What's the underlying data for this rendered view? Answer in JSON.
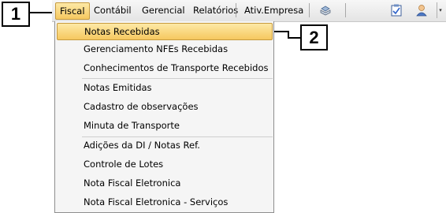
{
  "callouts": {
    "one": "1",
    "two": "2"
  },
  "menubar": {
    "items": [
      "Fiscal",
      "Contábil",
      "Gerencial",
      "Relatórios",
      "Ativ.Empresa"
    ],
    "icons": [
      "printer-icon",
      "checklist-icon",
      "user-icon"
    ],
    "overflow": "▾"
  },
  "dropdown": {
    "groups": [
      [
        "Notas Recebidas",
        "Gerenciamento NFEs Recebidas",
        "Conhecimentos de Transporte Recebidos"
      ],
      [
        "Notas Emitidas",
        "Cadastro de observações",
        "Minuta de Transporte"
      ],
      [
        "Adições da DI / Notas Ref.",
        "Controle de Lotes",
        "Nota Fiscal Eletronica",
        "Nota Fiscal Eletronica - Serviços"
      ]
    ],
    "highlighted": "Notas Recebidas"
  },
  "colors": {
    "highlight_top": "#fde9a6",
    "highlight_bottom": "#f6c85f",
    "highlight_border": "#c69a3e"
  }
}
